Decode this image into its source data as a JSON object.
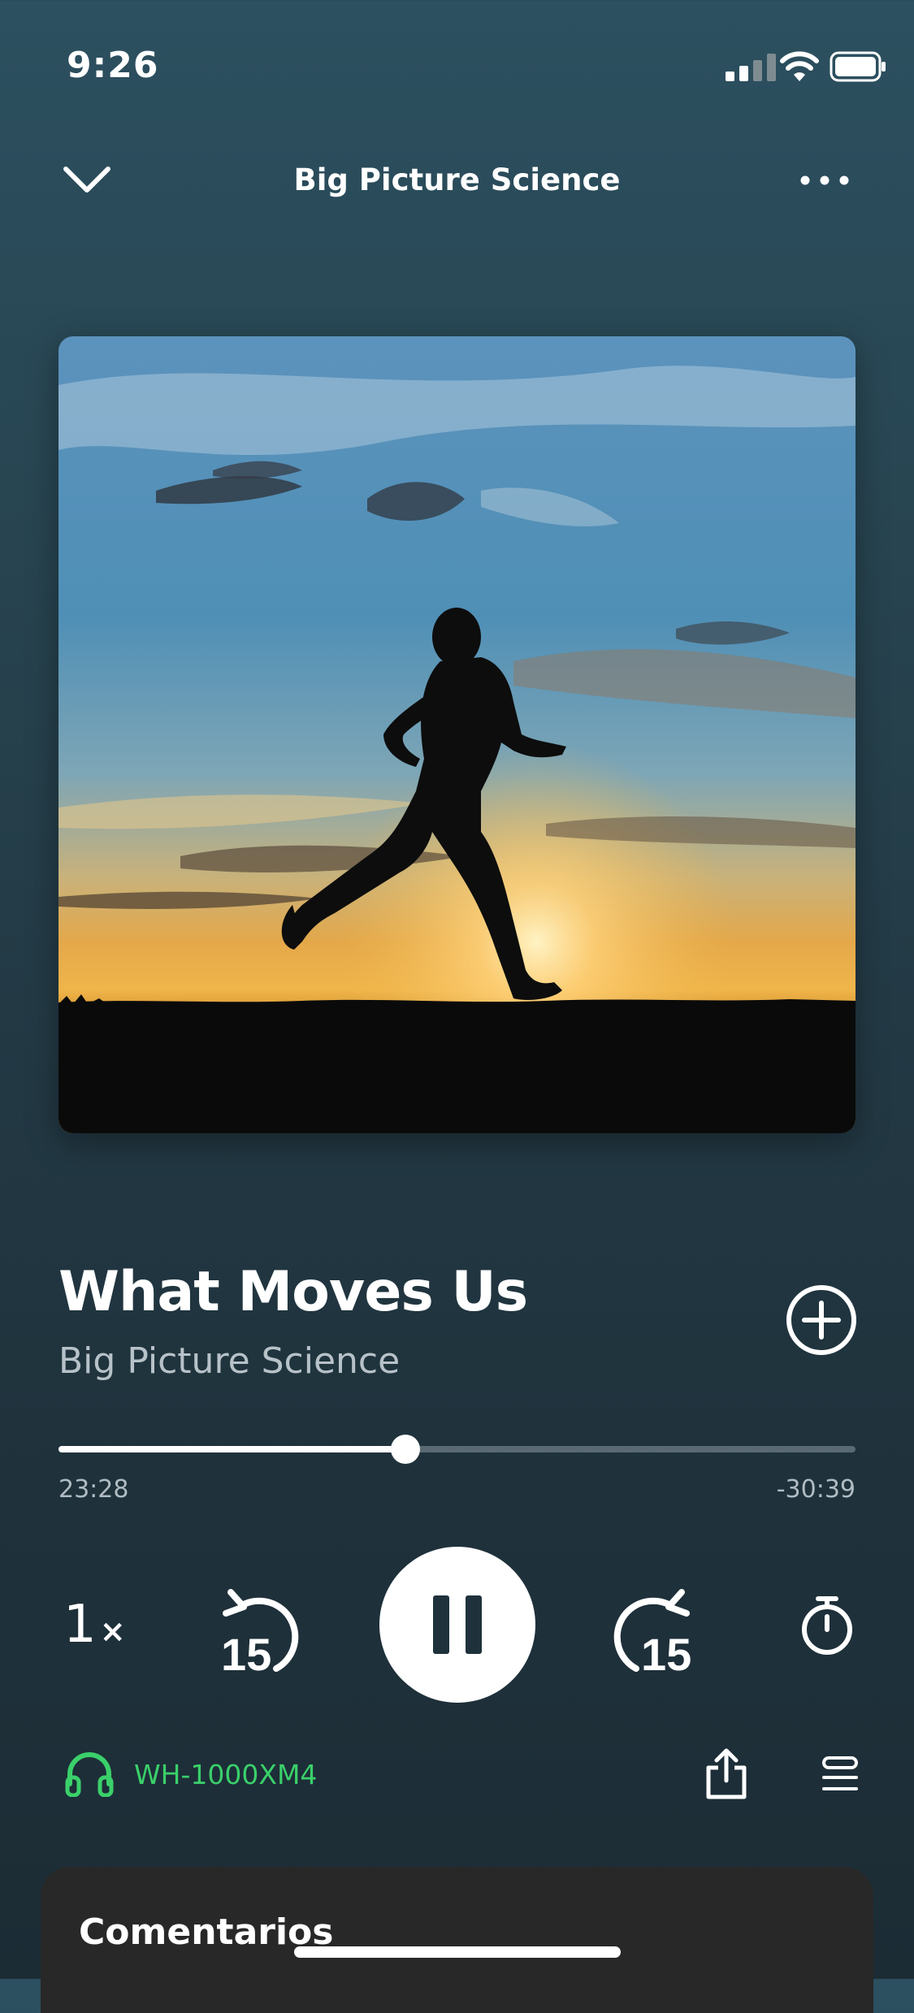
{
  "status_bar": {
    "time": "9:26"
  },
  "header": {
    "title": "Big Picture Science"
  },
  "episode": {
    "title": "What Moves Us",
    "show": "Big Picture Science"
  },
  "player": {
    "elapsed": "23:28",
    "remaining": "-30:39",
    "progress": 0.435,
    "speed": "1",
    "speed_suffix": "×",
    "skip_back_seconds": "15",
    "skip_forward_seconds": "15",
    "state": "playing"
  },
  "device": {
    "name": "WH-1000XM4",
    "color": "#3ad06a"
  },
  "comments": {
    "title": "Comentarios"
  },
  "icons": {
    "collapse": "chevron-down-icon",
    "more": "more-horizontal-icon",
    "add": "plus-circle-icon",
    "rewind": "rewind-15-icon",
    "pause": "pause-icon",
    "forward": "forward-15-icon",
    "timer": "sleep-timer-icon",
    "headphones": "headphones-icon",
    "share": "share-icon",
    "queue": "queue-icon"
  }
}
